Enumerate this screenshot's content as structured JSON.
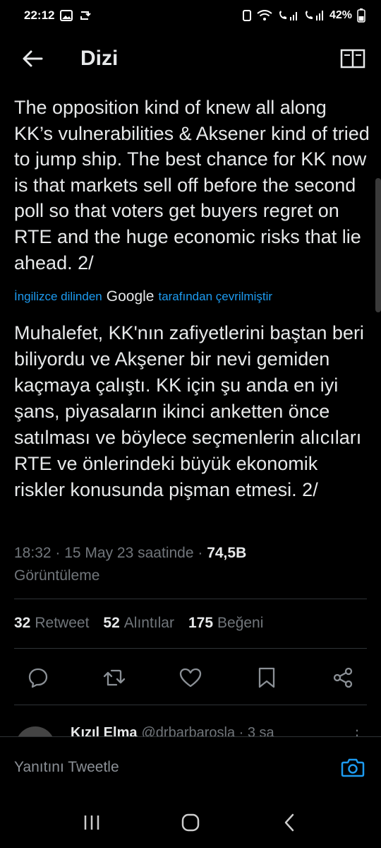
{
  "status_bar": {
    "time": "22:12",
    "battery": "42%"
  },
  "header": {
    "title": "Dizi",
    "back_icon": "arrow-left-icon",
    "reader_icon": "book-open-icon"
  },
  "tweet": {
    "text": "The opposition kind of knew all along KK’s vulnerabilities & Aksener kind of tried to jump ship. The best chance for KK now is that markets sell off before the second poll so that voters get buyers regret on RTE and the huge economic risks that lie ahead. 2/",
    "translation_prefix": "İngilizce dilinden",
    "translation_provider": "Google",
    "translation_suffix": "tarafından çevrilmiştir",
    "translated_text": "Muhalefet, KK'nın zafiyetlerini baştan beri biliyordu ve Akşener bir nevi gemiden kaçmaya çalıştı. KK için şu anda en iyi şans, piyasaların ikinci anketten önce satılması ve böylece seçmenlerin alıcıları RTE ve önlerindeki büyük ekonomik riskler konusunda pişman etmesi. 2/",
    "time": "18:32",
    "date": "15 May 23 saatinde",
    "views_count": "74,5B",
    "views_label": "Görüntüleme",
    "retweets_count": "32",
    "retweets_label": "Retweet",
    "quotes_count": "52",
    "quotes_label": "Alıntılar",
    "likes_count": "175",
    "likes_label": "Beğeni"
  },
  "reply_preview": {
    "name": "Kızıl Elma",
    "handle": "@drbarbarosla · 3 sa"
  },
  "reply_bar": {
    "placeholder": "Yanıtını Tweetle"
  },
  "colors": {
    "background": "#000000",
    "text": "#e7e9ea",
    "muted": "#71767b",
    "accent": "#1d9bf0"
  }
}
